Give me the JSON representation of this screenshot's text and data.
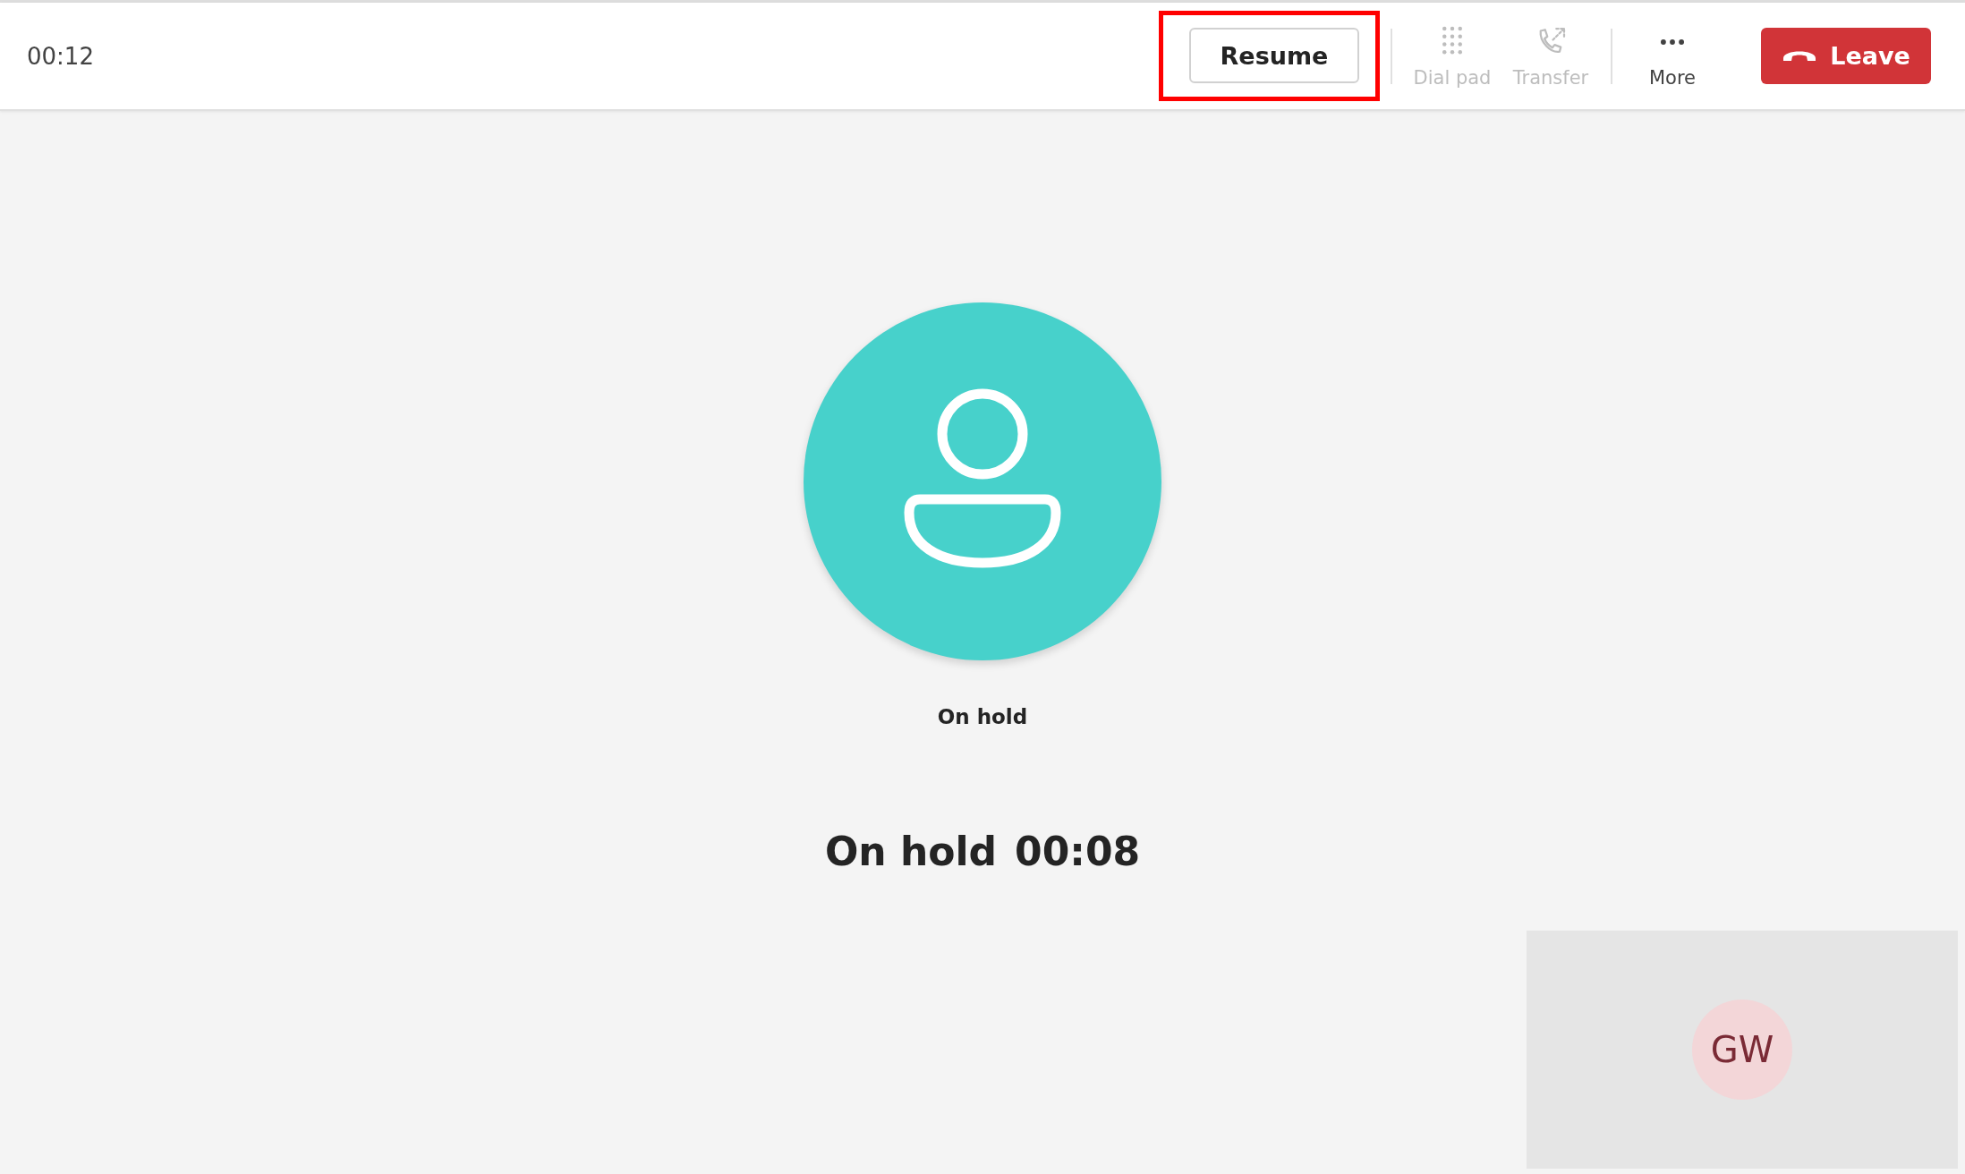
{
  "call_timer": "00:12",
  "resume_button": {
    "label": "Resume",
    "highlighted": true
  },
  "toolbar": [
    {
      "kind": "dialpad",
      "label": "Dial pad",
      "disabled": true
    },
    {
      "kind": "transfer",
      "label": "Transfer",
      "disabled": true
    },
    {
      "kind": "more",
      "label": "More",
      "disabled": false
    }
  ],
  "leave_button": {
    "label": "Leave"
  },
  "participant": {
    "status": "On hold"
  },
  "hold_status": {
    "label": "On hold",
    "timer": "00:08"
  },
  "self_view": {
    "initials": "GW"
  }
}
